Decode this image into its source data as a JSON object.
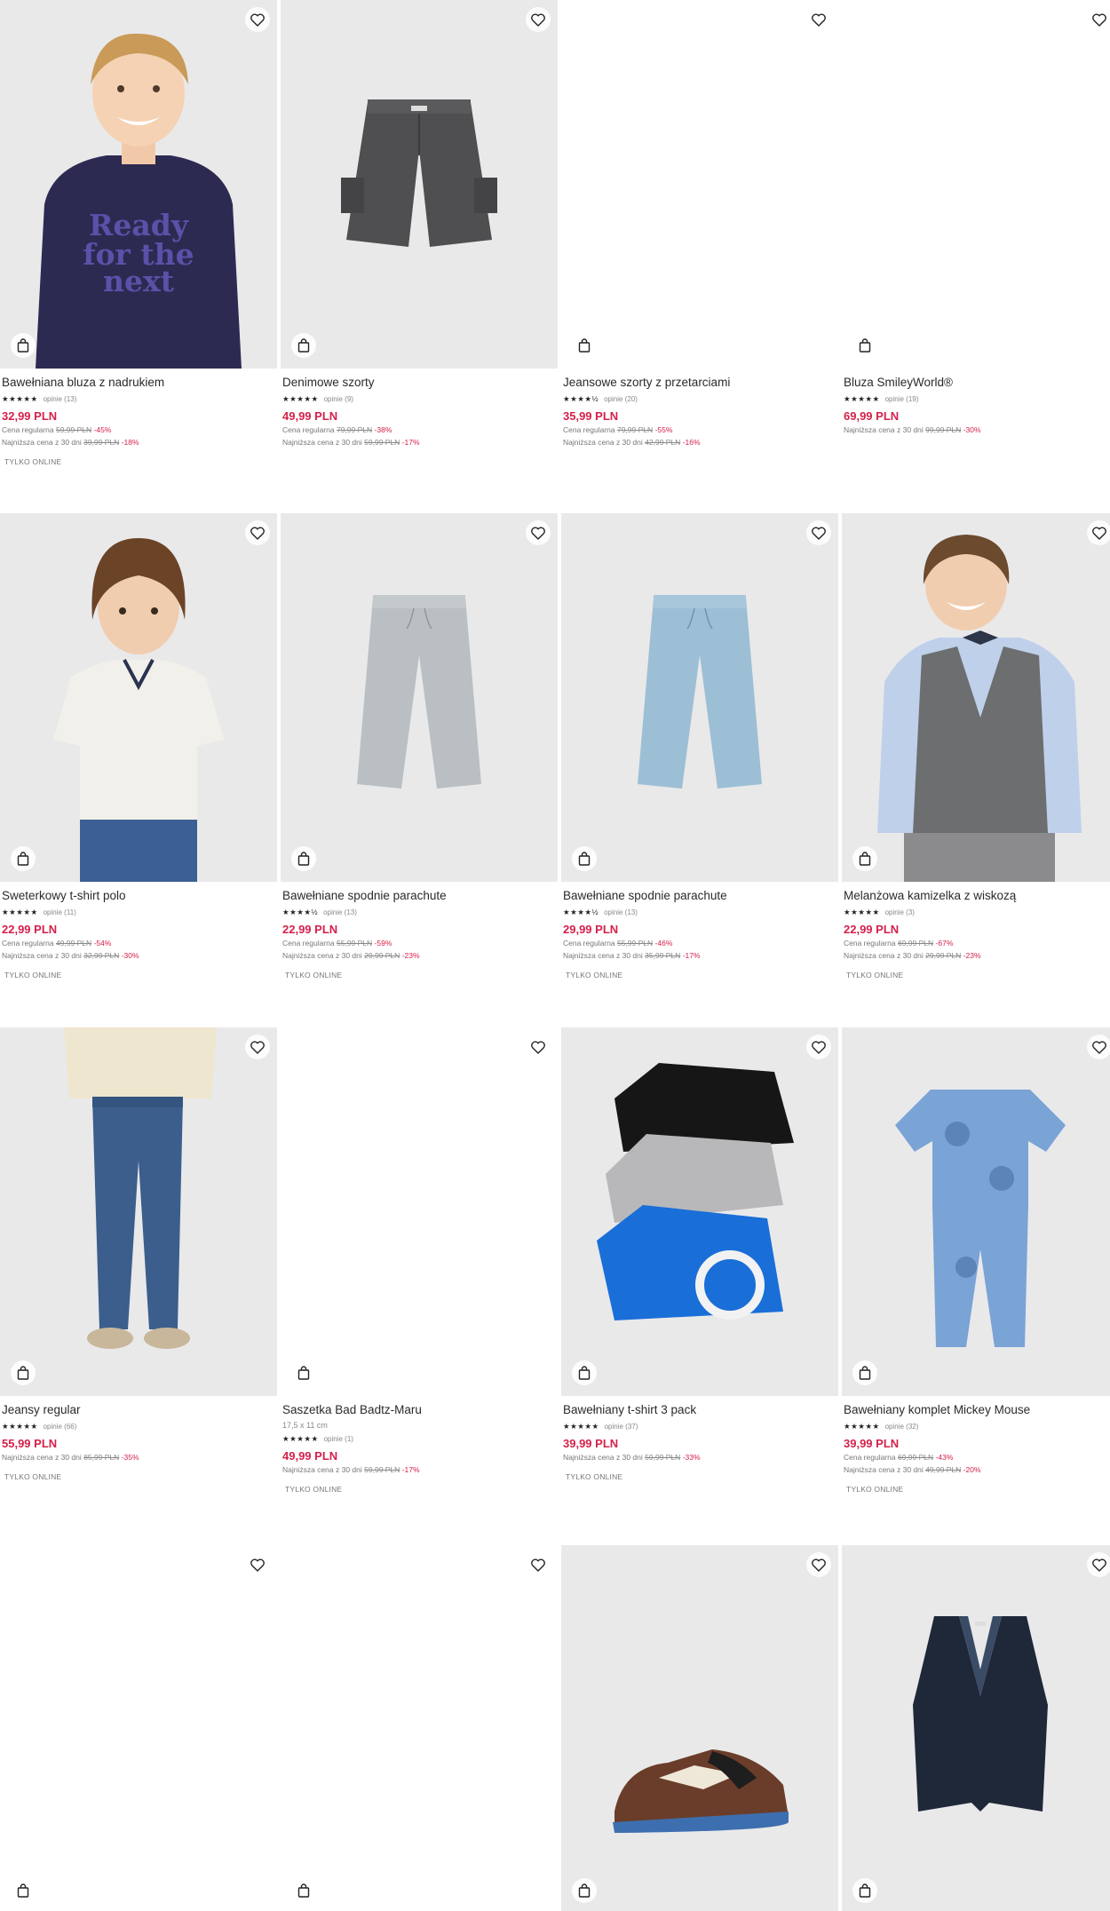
{
  "products": [
    {
      "name": "Bawełniana bluza z nadrukiem",
      "stars": "★★★★★",
      "reviews": "opinie (13)",
      "price": "32,99 PLN",
      "regular_label": "Cena regularna",
      "regular_old": "59,99 PLN",
      "regular_disc": "-45%",
      "lowest_label": "Najniższa cena z 30 dni",
      "lowest_old": "39,99 PLN",
      "lowest_disc": "-18%",
      "badge": "TYLKO ONLINE"
    },
    {
      "name": "Denimowe szorty",
      "stars": "★★★★★",
      "reviews": "opinie (9)",
      "price": "49,99 PLN",
      "regular_label": "Cena regularna",
      "regular_old": "79,99 PLN",
      "regular_disc": "-38%",
      "lowest_label": "Najniższa cena z 30 dni",
      "lowest_old": "59,99 PLN",
      "lowest_disc": "-17%"
    },
    {
      "name": "Jeansowe szorty z przetarciami",
      "stars": "★★★★½",
      "reviews": "opinie (20)",
      "price": "35,99 PLN",
      "regular_label": "Cena regularna",
      "regular_old": "79,99 PLN",
      "regular_disc": "-55%",
      "lowest_label": "Najniższa cena z 30 dni",
      "lowest_old": "42,99 PLN",
      "lowest_disc": "-16%"
    },
    {
      "name": "Bluza SmileyWorld®",
      "stars": "★★★★★",
      "reviews": "opinie (19)",
      "price": "69,99 PLN",
      "lowest_label": "Najniższa cena z 30 dni",
      "lowest_old": "99,99 PLN",
      "lowest_disc": "-30%"
    },
    {
      "name": "Sweterkowy t-shirt polo",
      "stars": "★★★★★",
      "reviews": "opinie (11)",
      "price": "22,99 PLN",
      "regular_label": "Cena regularna",
      "regular_old": "49,99 PLN",
      "regular_disc": "-54%",
      "lowest_label": "Najniższa cena z 30 dni",
      "lowest_old": "32,99 PLN",
      "lowest_disc": "-30%",
      "badge": "TYLKO ONLINE"
    },
    {
      "name": "Bawełniane spodnie parachute",
      "stars": "★★★★½",
      "reviews": "opinie (13)",
      "price": "22,99 PLN",
      "regular_label": "Cena regularna",
      "regular_old": "55,99 PLN",
      "regular_disc": "-59%",
      "lowest_label": "Najniższa cena z 30 dni",
      "lowest_old": "29,99 PLN",
      "lowest_disc": "-23%",
      "badge": "TYLKO ONLINE"
    },
    {
      "name": "Bawełniane spodnie parachute",
      "stars": "★★★★½",
      "reviews": "opinie (13)",
      "price": "29,99 PLN",
      "regular_label": "Cena regularna",
      "regular_old": "55,99 PLN",
      "regular_disc": "-46%",
      "lowest_label": "Najniższa cena z 30 dni",
      "lowest_old": "35,99 PLN",
      "lowest_disc": "-17%",
      "badge": "TYLKO ONLINE"
    },
    {
      "name": "Melanżowa kamizelka z wiskozą",
      "stars": "★★★★★",
      "reviews": "opinie (3)",
      "price": "22,99 PLN",
      "regular_label": "Cena regularna",
      "regular_old": "69,99 PLN",
      "regular_disc": "-67%",
      "lowest_label": "Najniższa cena z 30 dni",
      "lowest_old": "29,99 PLN",
      "lowest_disc": "-23%",
      "badge": "TYLKO ONLINE"
    },
    {
      "name": "Jeansy regular",
      "stars": "★★★★★",
      "reviews": "opinie (66)",
      "price": "55,99 PLN",
      "lowest_label": "Najniższa cena z 30 dni",
      "lowest_old": "85,99 PLN",
      "lowest_disc": "-35%",
      "badge": "TYLKO ONLINE"
    },
    {
      "name": "Saszetka Bad Badtz-Maru",
      "sub": "17,5 x 11 cm",
      "stars": "★★★★★",
      "reviews": "opinie (1)",
      "price": "49,99 PLN",
      "lowest_label": "Najniższa cena z 30 dni",
      "lowest_old": "59,99 PLN",
      "lowest_disc": "-17%",
      "badge": "TYLKO ONLINE"
    },
    {
      "name": "Bawełniany t-shirt 3 pack",
      "stars": "★★★★★",
      "reviews": "opinie (37)",
      "price": "39,99 PLN",
      "lowest_label": "Najniższa cena z 30 dni",
      "lowest_old": "59,99 PLN",
      "lowest_disc": "-33%",
      "badge": "TYLKO ONLINE"
    },
    {
      "name": "Bawełniany komplet Mickey Mouse",
      "stars": "★★★★★",
      "reviews": "opinie (32)",
      "price": "39,99 PLN",
      "regular_label": "Cena regularna",
      "regular_old": "69,99 PLN",
      "regular_disc": "-43%",
      "lowest_label": "Najniższa cena z 30 dni",
      "lowest_old": "49,99 PLN",
      "lowest_disc": "-20%",
      "badge": "TYLKO ONLINE"
    },
    {},
    {},
    {},
    {}
  ],
  "icons": {
    "favorite": "heart-icon",
    "cart": "bag-icon"
  },
  "colors": {
    "price": "#d4214a",
    "discount": "#d4214a"
  }
}
